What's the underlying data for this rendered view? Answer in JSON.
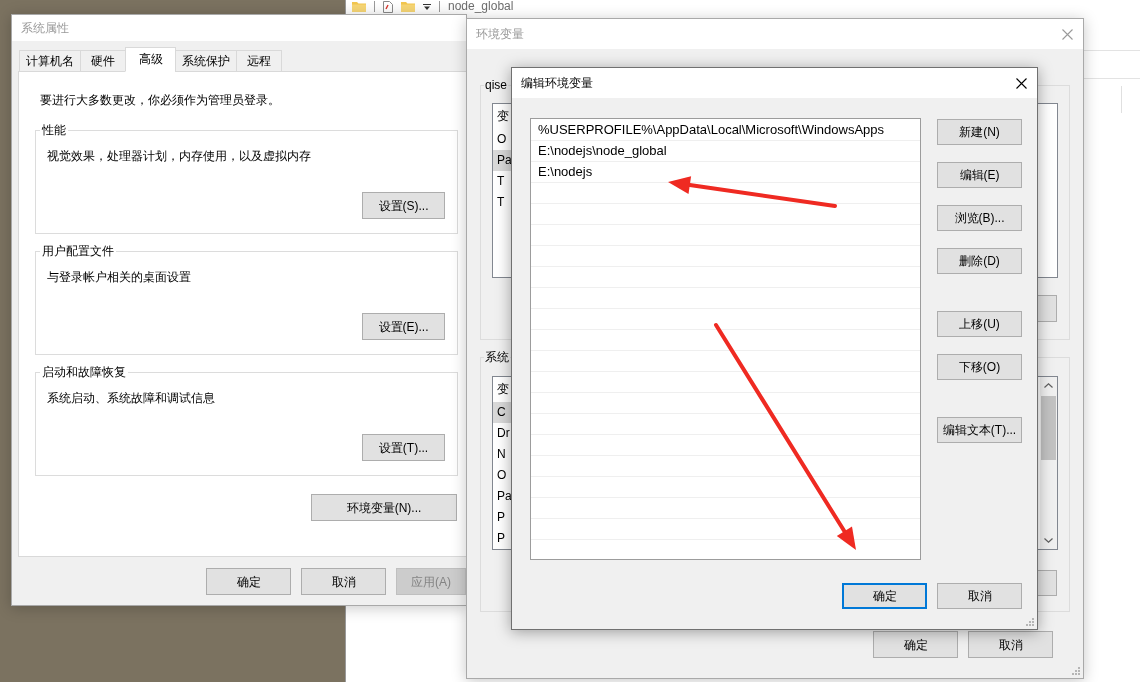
{
  "explorer": {
    "title": "node_global"
  },
  "system_properties": {
    "title": "系统属性",
    "active": false,
    "tabs": [
      {
        "label": "计算机名",
        "selected": false
      },
      {
        "label": "硬件",
        "selected": false
      },
      {
        "label": "高级",
        "selected": true
      },
      {
        "label": "系统保护",
        "selected": false
      },
      {
        "label": "远程",
        "selected": false
      }
    ],
    "notice": "要进行大多数更改，你必须作为管理员登录。",
    "groups": [
      {
        "title": "性能",
        "description": "视觉效果，处理器计划，内存使用，以及虚拟内存",
        "button": "设置(S)..."
      },
      {
        "title": "用户配置文件",
        "description": "与登录帐户相关的桌面设置",
        "button": "设置(E)..."
      },
      {
        "title": "启动和故障恢复",
        "description": "系统启动、系统故障和调试信息",
        "button": "设置(T)..."
      }
    ],
    "environment_button": "环境变量(N)...",
    "buttons": [
      {
        "label": "确定",
        "disabled": false
      },
      {
        "label": "取消",
        "disabled": false
      },
      {
        "label": "应用(A)",
        "disabled": true
      }
    ]
  },
  "environment_variables": {
    "title": "环境变量",
    "active": false,
    "user_variables": {
      "title": "qise",
      "header": "变",
      "rows": [
        {
          "name": "O",
          "selected": false
        },
        {
          "name": "Pa",
          "selected": true
        },
        {
          "name": "T",
          "selected": false
        },
        {
          "name": "T",
          "selected": false
        }
      ]
    },
    "system_variables": {
      "title": "系统",
      "header": "变",
      "rows": [
        {
          "name": "C",
          "selected": true
        },
        {
          "name": "Dr",
          "selected": false
        },
        {
          "name": "N",
          "selected": false
        },
        {
          "name": "O",
          "selected": false
        },
        {
          "name": "Pa",
          "selected": false
        },
        {
          "name": "P",
          "selected": false
        },
        {
          "name": "P",
          "selected": false
        }
      ]
    },
    "buttons": [
      "确定",
      "取消"
    ]
  },
  "edit_dialog": {
    "title": "编辑环境变量",
    "active": true,
    "paths": [
      "%USERPROFILE%\\AppData\\Local\\Microsoft\\WindowsApps",
      "E:\\nodejs\\node_global",
      "E:\\nodejs"
    ],
    "side_buttons": [
      [
        "新建(N)",
        "编辑(E)",
        "浏览(B)...",
        "删除(D)"
      ],
      [
        "上移(U)",
        "下移(O)"
      ],
      [
        "编辑文本(T)..."
      ]
    ],
    "buttons": [
      {
        "label": "确定",
        "default": true
      },
      {
        "label": "取消",
        "default": false
      }
    ]
  }
}
